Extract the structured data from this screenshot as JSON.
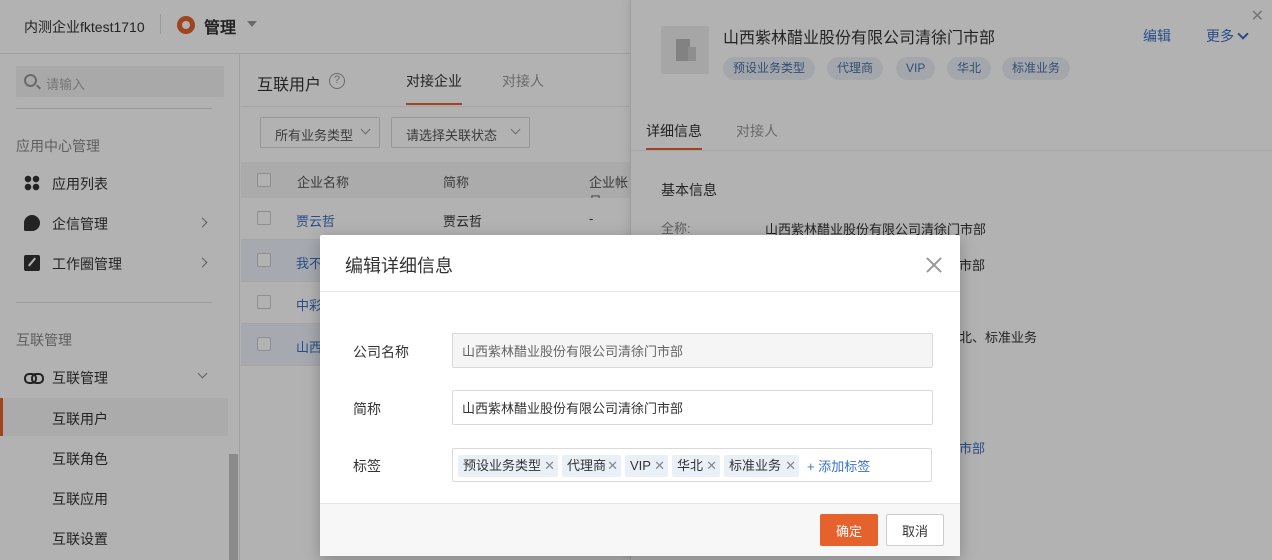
{
  "topbar": {
    "company": "内测企业fktest1710",
    "app_label": "管理"
  },
  "sidebar": {
    "search_placeholder": "请输入",
    "section1": "应用中心管理",
    "items1": [
      {
        "label": "应用列表"
      },
      {
        "label": "企信管理"
      },
      {
        "label": "工作圈管理"
      }
    ],
    "section2": "互联管理",
    "group": {
      "label": "互联管理"
    },
    "subitems": [
      {
        "label": "互联用户",
        "active": true
      },
      {
        "label": "互联角色"
      },
      {
        "label": "互联应用"
      },
      {
        "label": "互联设置"
      }
    ]
  },
  "main": {
    "title": "互联用户",
    "tabs": [
      {
        "label": "对接企业"
      },
      {
        "label": "对接人"
      }
    ],
    "filters": [
      {
        "label": "所有业务类型"
      },
      {
        "label": "请选择关联状态"
      }
    ],
    "columns": [
      "企业名称",
      "简称",
      "企业帐号"
    ],
    "rows": [
      {
        "name": "贾云哲",
        "short": "贾云哲",
        "account": "-"
      },
      {
        "name": "我不",
        "short": "",
        "account": ""
      },
      {
        "name": "中彩",
        "short": "",
        "account": ""
      },
      {
        "name": "山西",
        "short": "",
        "account": ""
      }
    ]
  },
  "panel": {
    "company_name": "山西紫林醋业股份有限公司清徐门市部",
    "tags": [
      "预设业务类型",
      "代理商",
      "VIP",
      "华北",
      "标准业务"
    ],
    "edit": "编辑",
    "more": "更多",
    "tabs": [
      {
        "label": "详细信息"
      },
      {
        "label": "对接人"
      }
    ],
    "section": "基本信息",
    "fields": [
      {
        "key": "全称:",
        "value": "山西紫林醋业股份有限公司清徐门市部"
      },
      {
        "key": "",
        "value": "市部"
      },
      {
        "key": "",
        "value": "北、标准业务"
      },
      {
        "key": "",
        "value": "市部"
      }
    ]
  },
  "modal": {
    "title": "编辑详细信息",
    "fields": {
      "company": {
        "label": "公司名称",
        "value": "山西紫林醋业股份有限公司清徐门市部"
      },
      "short": {
        "label": "简称",
        "value": "山西紫林醋业股份有限公司清徐门市部"
      },
      "tags": {
        "label": "标签"
      }
    },
    "tags": [
      "预设业务类型",
      "代理商",
      "VIP",
      "华北",
      "标准业务"
    ],
    "add_tag": "+ 添加标签",
    "ok": "确定",
    "cancel": "取消"
  },
  "colors": {
    "accent": "#e6622d",
    "link": "#3b6fc5",
    "tag_bg": "#eaf0f7"
  },
  "icons": [
    "gear-icon",
    "search-icon",
    "grid-icon",
    "chat-icon",
    "edit-icon",
    "link-icon",
    "help-icon",
    "building-icon",
    "close-icon",
    "chevron-down-icon"
  ]
}
